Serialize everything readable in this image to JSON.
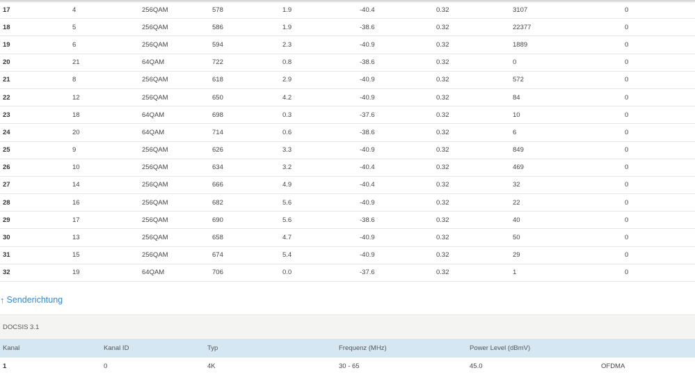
{
  "downstream_rows": [
    [
      "17",
      "4",
      "256QAM",
      "578",
      "1.9",
      "-40.4",
      "0.32",
      "3107",
      "0"
    ],
    [
      "18",
      "5",
      "256QAM",
      "586",
      "1.9",
      "-38.6",
      "0.32",
      "22377",
      "0"
    ],
    [
      "19",
      "6",
      "256QAM",
      "594",
      "2.3",
      "-40.9",
      "0.32",
      "1889",
      "0"
    ],
    [
      "20",
      "21",
      "64QAM",
      "722",
      "0.8",
      "-38.6",
      "0.32",
      "0",
      "0"
    ],
    [
      "21",
      "8",
      "256QAM",
      "618",
      "2.9",
      "-40.9",
      "0.32",
      "572",
      "0"
    ],
    [
      "22",
      "12",
      "256QAM",
      "650",
      "4.2",
      "-40.9",
      "0.32",
      "84",
      "0"
    ],
    [
      "23",
      "18",
      "64QAM",
      "698",
      "0.3",
      "-37.6",
      "0.32",
      "10",
      "0"
    ],
    [
      "24",
      "20",
      "64QAM",
      "714",
      "0.6",
      "-38.6",
      "0.32",
      "6",
      "0"
    ],
    [
      "25",
      "9",
      "256QAM",
      "626",
      "3.3",
      "-40.9",
      "0.32",
      "849",
      "0"
    ],
    [
      "26",
      "10",
      "256QAM",
      "634",
      "3.2",
      "-40.4",
      "0.32",
      "469",
      "0"
    ],
    [
      "27",
      "14",
      "256QAM",
      "666",
      "4.9",
      "-40.4",
      "0.32",
      "32",
      "0"
    ],
    [
      "28",
      "16",
      "256QAM",
      "682",
      "5.6",
      "-40.9",
      "0.32",
      "22",
      "0"
    ],
    [
      "29",
      "17",
      "256QAM",
      "690",
      "5.6",
      "-38.6",
      "0.32",
      "40",
      "0"
    ],
    [
      "30",
      "13",
      "256QAM",
      "658",
      "4.7",
      "-40.9",
      "0.32",
      "50",
      "0"
    ],
    [
      "31",
      "15",
      "256QAM",
      "674",
      "5.4",
      "-40.9",
      "0.32",
      "29",
      "0"
    ],
    [
      "32",
      "19",
      "64QAM",
      "706",
      "0.0",
      "-37.6",
      "0.32",
      "1",
      "0"
    ]
  ],
  "upstream": {
    "section_title": "Senderichtung",
    "section_icon": "arrow-up-icon",
    "docsis_label": "DOCSIS 3.1",
    "headers": [
      "Kanal",
      "Kanal ID",
      "Typ",
      "Frequenz (MHz)",
      "Power Level (dBmV)",
      ""
    ],
    "rows": [
      [
        "1",
        "0",
        "4K",
        "30 - 65",
        "45.0",
        "OFDMA"
      ]
    ]
  },
  "colors": {
    "link": "#3a86c8",
    "header_bg": "#d5e7f3",
    "docsis_bg": "#f4f4f2"
  }
}
